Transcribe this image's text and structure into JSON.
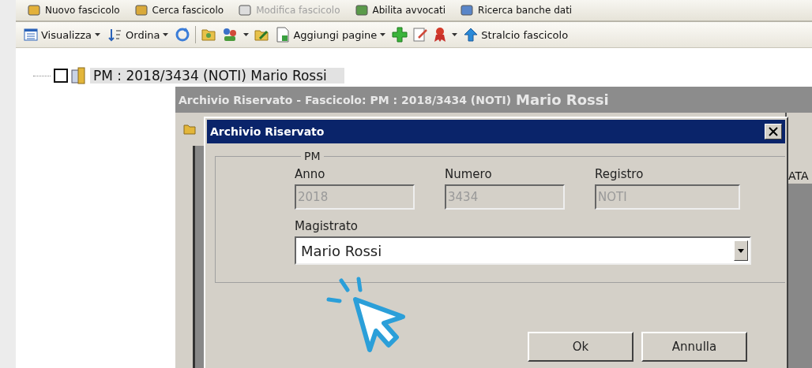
{
  "top_toolbar": {
    "items": [
      {
        "label": "Nuovo fascicolo",
        "disabled": false
      },
      {
        "label": "Cerca fascicolo",
        "disabled": false
      },
      {
        "label": "Modifica fascicolo",
        "disabled": true
      },
      {
        "label": "Abilita avvocati",
        "disabled": false
      },
      {
        "label": "Ricerca banche dati",
        "disabled": false
      }
    ]
  },
  "toolbar": {
    "items": [
      {
        "kind": "dropdown",
        "label": "Visualizza"
      },
      {
        "kind": "dropdown",
        "label": "Ordina"
      },
      {
        "kind": "icon"
      },
      {
        "kind": "separator"
      },
      {
        "kind": "icon"
      },
      {
        "kind": "icon-dropdown"
      },
      {
        "kind": "icon"
      },
      {
        "kind": "dropdown",
        "label": "Aggiungi pagine"
      },
      {
        "kind": "icon"
      },
      {
        "kind": "icon"
      },
      {
        "kind": "icon-dropdown"
      },
      {
        "kind": "button",
        "label": "Stralcio fascicolo"
      }
    ]
  },
  "tree": {
    "nodes": [
      {
        "label": "PM : 2018/3434 (NOTI)",
        "name": "Mario Rossi",
        "checked": false,
        "selected": true
      }
    ]
  },
  "background_window": {
    "title": "Archivio Riservato - Fascicolo: PM : 2018/3434 (NOTI)",
    "title_name": "Mario Rossi",
    "column_header": "ATA"
  },
  "dialog": {
    "title": "Archivio Riservato",
    "group": "PM",
    "fields": [
      {
        "label": "Anno",
        "value": "2018",
        "disabled": true
      },
      {
        "label": "Numero",
        "value": "3434",
        "disabled": true
      },
      {
        "label": "Registro",
        "value": "NOTI",
        "disabled": true
      }
    ],
    "magistrato": {
      "label": "Magistrato",
      "value": "Mario Rossi"
    },
    "buttons": [
      "Ok",
      "Annulla"
    ]
  }
}
